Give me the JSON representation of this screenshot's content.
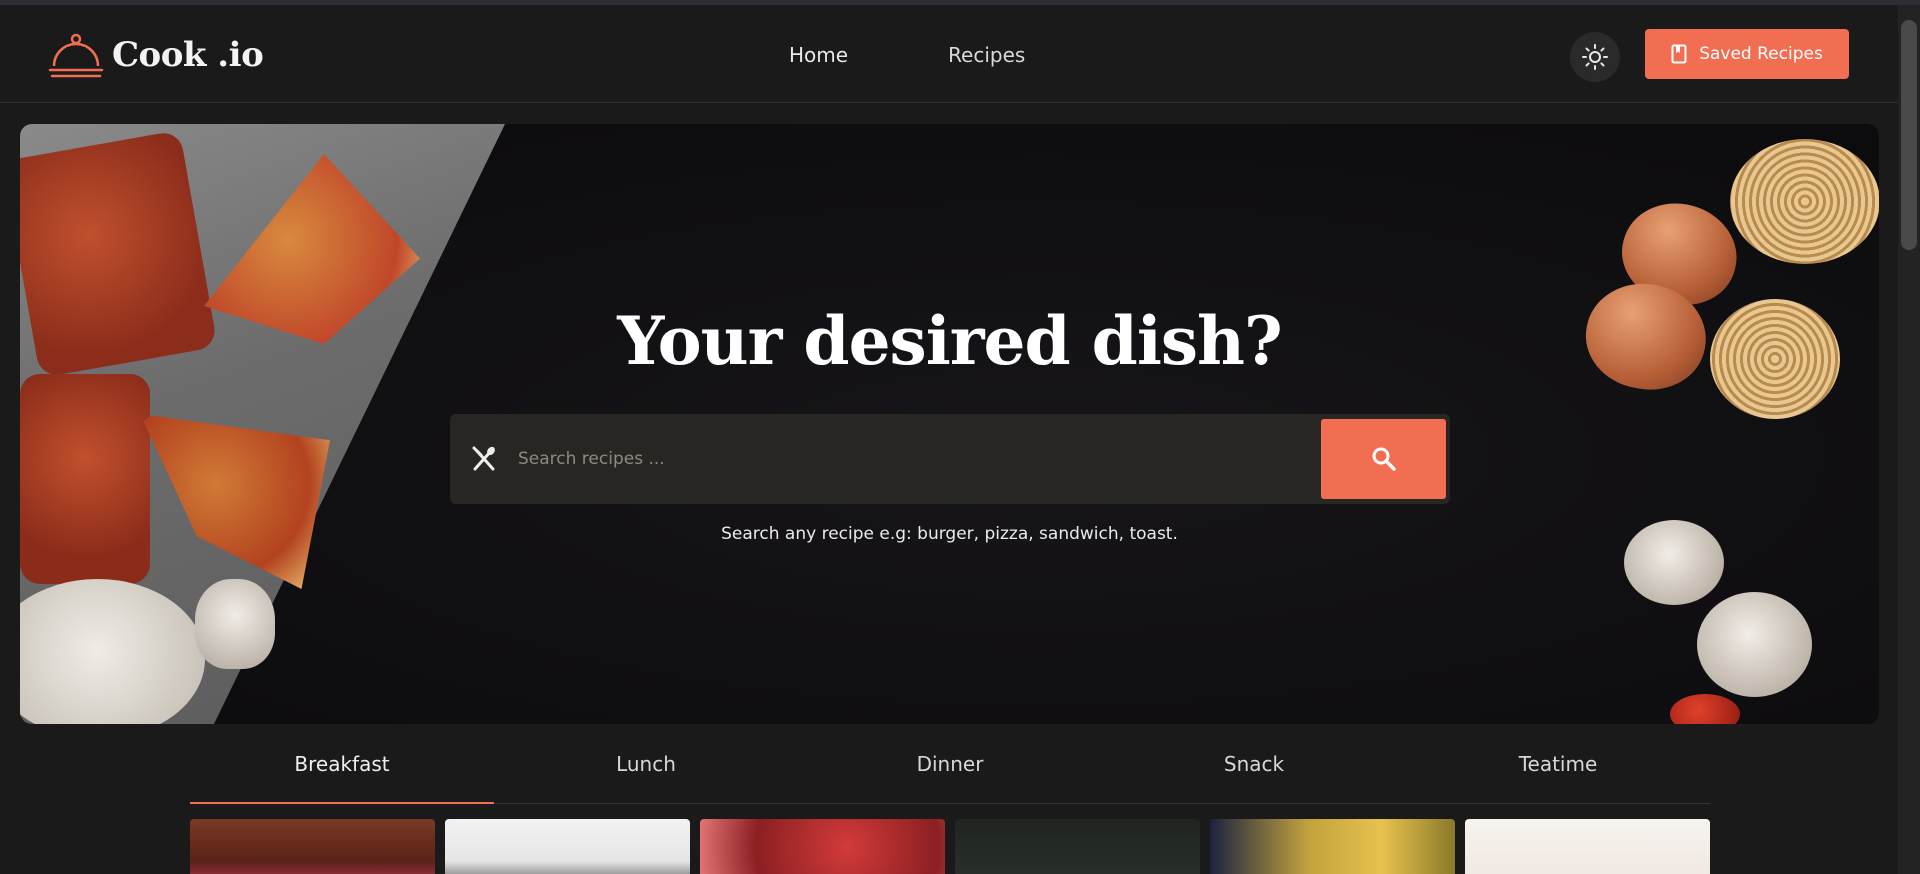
{
  "header": {
    "logo_text": "Cook .io",
    "logo_icon": "cloche-icon",
    "nav": [
      {
        "label": "Home"
      },
      {
        "label": "Recipes"
      }
    ],
    "theme_toggle_icon": "sun-icon",
    "saved_button": {
      "label": "Saved Recipes",
      "icon": "bookmark-icon"
    }
  },
  "hero": {
    "title": "Your desired dish?",
    "search": {
      "placeholder": "Search recipes ...",
      "value": "",
      "left_icon": "utensils-icon",
      "button_icon": "search-icon"
    },
    "hint": "Search any recipe e.g: burger, pizza, sandwich, toast."
  },
  "tabs": [
    {
      "label": "Breakfast",
      "active": true
    },
    {
      "label": "Lunch",
      "active": false
    },
    {
      "label": "Dinner",
      "active": false
    },
    {
      "label": "Snack",
      "active": false
    },
    {
      "label": "Teatime",
      "active": false
    }
  ],
  "colors": {
    "accent": "#f26e52",
    "background": "#1a1a1a",
    "search_bg": "#282623"
  }
}
